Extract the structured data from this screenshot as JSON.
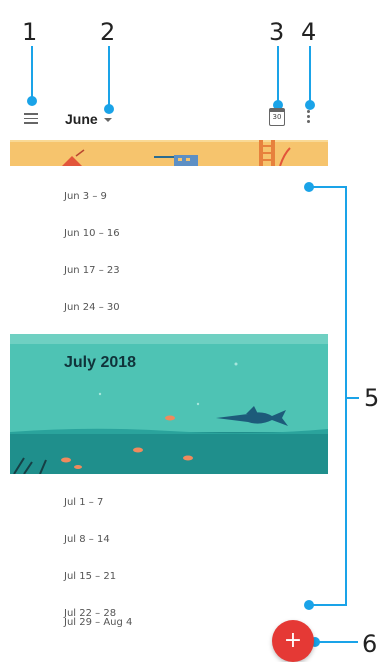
{
  "callouts": [
    "1",
    "2",
    "3",
    "4",
    "5",
    "6"
  ],
  "header": {
    "month": "June",
    "calendar_day": "30"
  },
  "june_weeks": [
    "Jun 3 – 9",
    "Jun 10 – 16",
    "Jun 17 – 23",
    "Jun 24 – 30"
  ],
  "july_banner": {
    "title": "July 2018"
  },
  "july_weeks": [
    "Jul 1 – 7",
    "Jul 8 – 14",
    "Jul 15 – 21",
    "Jul 22 – 28",
    "Jul 29 – Aug 4"
  ],
  "fab": {
    "label": "+"
  },
  "colors": {
    "accent": "#1aa3e8",
    "fab": "#e53935",
    "july_sea": "#4ec3b4",
    "june_banner": "#f6c46d"
  }
}
